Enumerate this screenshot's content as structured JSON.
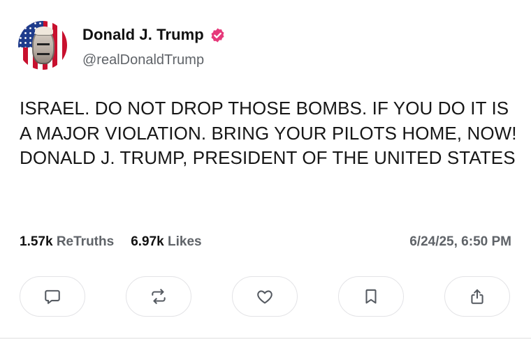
{
  "author": {
    "display_name": "Donald J. Trump",
    "handle": "@realDonaldTrump",
    "verified": true,
    "verified_badge_color": "#e6397a",
    "avatar_icon": "american-flag-portrait"
  },
  "post": {
    "text": "ISRAEL. DO NOT DROP THOSE BOMBS. IF YOU DO IT IS A MAJOR VIOLATION. BRING YOUR PILOTS HOME, NOW! DONALD J. TRUMP, PRESIDENT OF THE UNITED STATES"
  },
  "stats": {
    "retruths_count": "1.57k",
    "retruths_label": "ReTruths",
    "likes_count": "6.97k",
    "likes_label": "Likes",
    "timestamp": "6/24/25, 6:50 PM"
  },
  "actions": [
    {
      "name": "reply",
      "icon": "comment-icon"
    },
    {
      "name": "retruth",
      "icon": "repost-icon"
    },
    {
      "name": "like",
      "icon": "heart-icon"
    },
    {
      "name": "bookmark",
      "icon": "bookmark-icon"
    },
    {
      "name": "share",
      "icon": "share-icon"
    }
  ],
  "colors": {
    "text": "#111111",
    "secondary_text": "#5f6368",
    "border": "#e3e3e6",
    "icon": "#555a61"
  }
}
